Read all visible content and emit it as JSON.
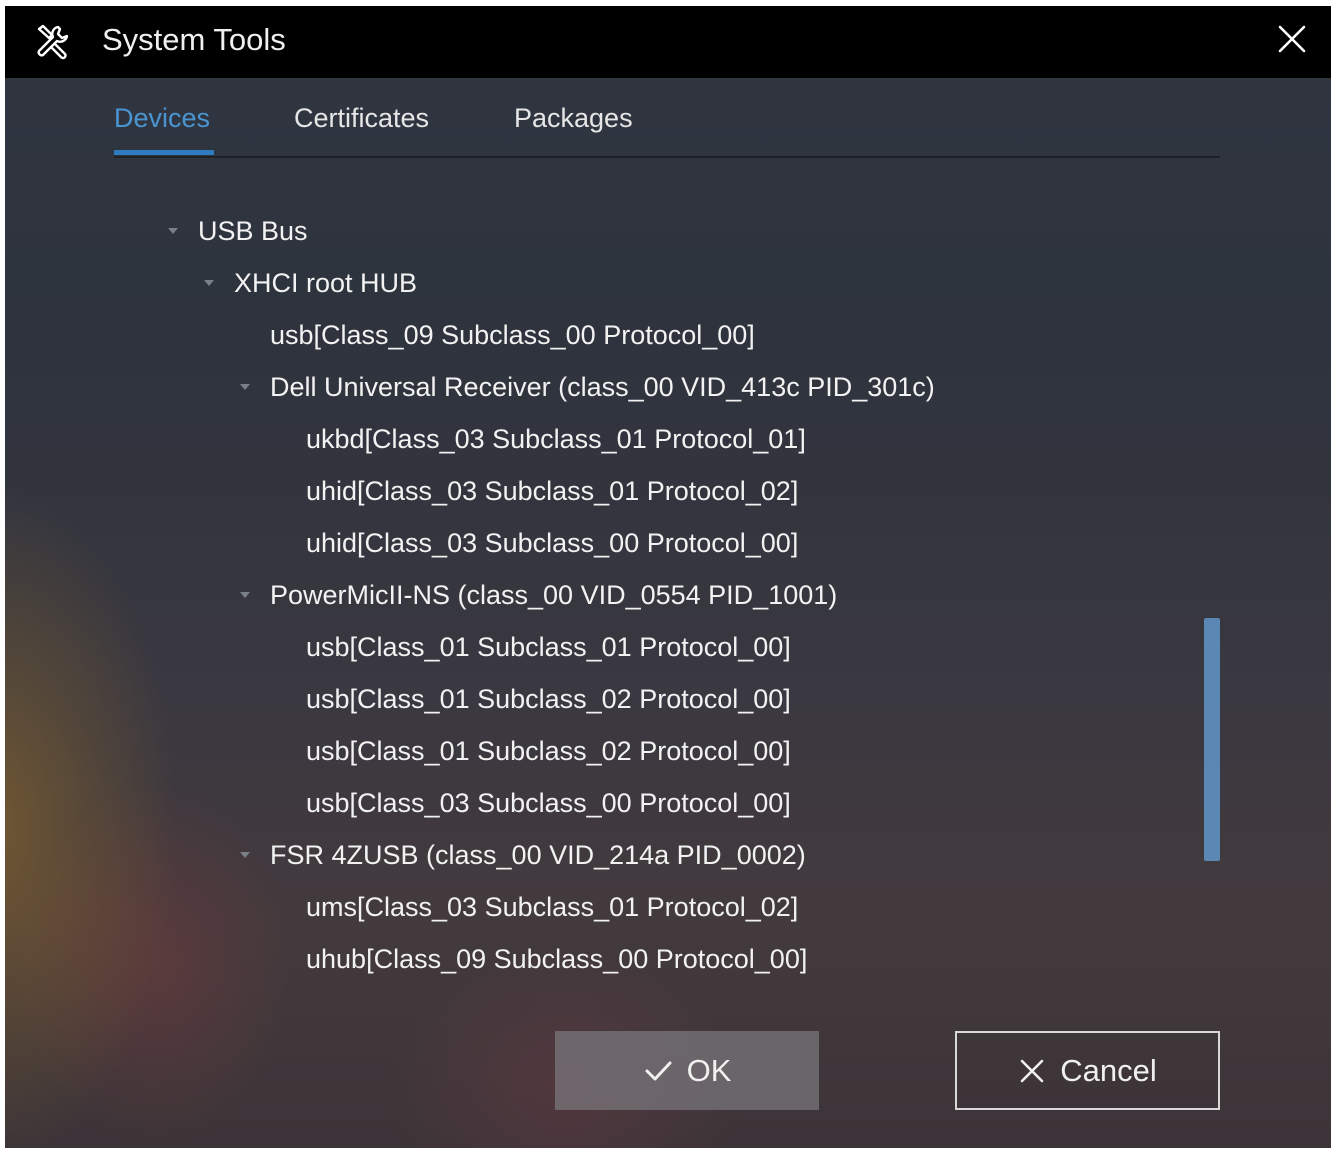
{
  "window": {
    "title": "System Tools",
    "app_icon": "tools-icon",
    "close_icon": "close-icon"
  },
  "tabs": [
    {
      "label": "Devices",
      "active": true
    },
    {
      "label": "Certificates",
      "active": false
    },
    {
      "label": "Packages",
      "active": false
    }
  ],
  "tree": [
    {
      "label": "USB Bus",
      "depth": 0,
      "expandable": true,
      "expanded": true
    },
    {
      "label": "XHCI root HUB",
      "depth": 1,
      "expandable": true,
      "expanded": true
    },
    {
      "label": "usb[Class_09 Subclass_00 Protocol_00]",
      "depth": 2,
      "expandable": false
    },
    {
      "label": "Dell Universal Receiver (class_00 VID_413c PID_301c)",
      "depth": 2,
      "expandable": true,
      "expanded": true
    },
    {
      "label": "ukbd[Class_03 Subclass_01 Protocol_01]",
      "depth": 3,
      "expandable": false
    },
    {
      "label": "uhid[Class_03 Subclass_01 Protocol_02]",
      "depth": 3,
      "expandable": false
    },
    {
      "label": "uhid[Class_03 Subclass_00 Protocol_00]",
      "depth": 3,
      "expandable": false
    },
    {
      "label": "PowerMicII-NS (class_00 VID_0554 PID_1001)",
      "depth": 2,
      "expandable": true,
      "expanded": true
    },
    {
      "label": "usb[Class_01 Subclass_01 Protocol_00]",
      "depth": 3,
      "expandable": false
    },
    {
      "label": "usb[Class_01 Subclass_02 Protocol_00]",
      "depth": 3,
      "expandable": false
    },
    {
      "label": "usb[Class_01 Subclass_02 Protocol_00]",
      "depth": 3,
      "expandable": false
    },
    {
      "label": "usb[Class_03 Subclass_00 Protocol_00]",
      "depth": 3,
      "expandable": false
    },
    {
      "label": "FSR 4ZUSB (class_00 VID_214a PID_0002)",
      "depth": 2,
      "expandable": true,
      "expanded": true
    },
    {
      "label": "ums[Class_03 Subclass_01 Protocol_02]",
      "depth": 3,
      "expandable": false
    },
    {
      "label": "uhub[Class_09 Subclass_00 Protocol_00]",
      "depth": 3,
      "expandable": false
    }
  ],
  "buttons": {
    "ok_label": "OK",
    "ok_icon": "check-icon",
    "cancel_label": "Cancel",
    "cancel_icon": "close-icon"
  },
  "colors": {
    "accent": "#4a95d1",
    "tab_indicator": "#2f7bc0",
    "scrollbar": "#5b87b5"
  }
}
